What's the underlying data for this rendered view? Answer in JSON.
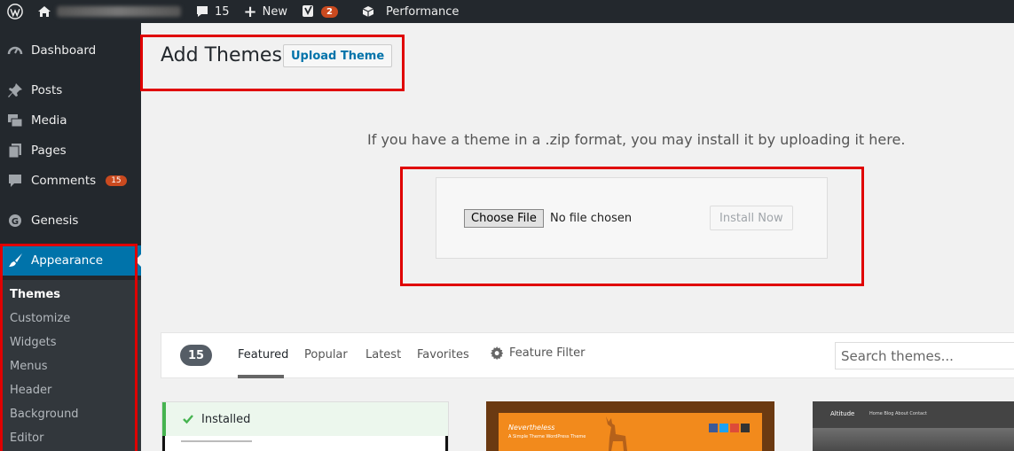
{
  "admin_bar": {
    "comments_count": "15",
    "new_label": "New",
    "seo_badge": "2",
    "performance_label": "Performance"
  },
  "sidebar": {
    "items": [
      {
        "label": "Dashboard",
        "icon": "dashboard-icon"
      },
      {
        "label": "Posts",
        "icon": "pin-icon"
      },
      {
        "label": "Media",
        "icon": "media-icon"
      },
      {
        "label": "Pages",
        "icon": "pages-icon"
      },
      {
        "label": "Comments",
        "icon": "comment-icon",
        "badge": "15"
      },
      {
        "label": "Genesis",
        "icon": "genesis-icon"
      },
      {
        "label": "Appearance",
        "icon": "paintbrush-icon",
        "active": true
      }
    ],
    "submenu": [
      "Themes",
      "Customize",
      "Widgets",
      "Menus",
      "Header",
      "Background",
      "Editor"
    ]
  },
  "main": {
    "title": "Add Themes",
    "upload_button": "Upload Theme",
    "upload_help": "If you have a theme in a .zip format, you may install it by uploading it here.",
    "choose_file": "Choose File",
    "no_file": "No file chosen",
    "install_now": "Install Now"
  },
  "filter_bar": {
    "count": "15",
    "tabs": [
      "Featured",
      "Popular",
      "Latest",
      "Favorites"
    ],
    "feature_filter": "Feature Filter",
    "search_placeholder": "Search themes..."
  },
  "themes": [
    {
      "status": "Installed"
    },
    {
      "preview_title": "Nevertheless",
      "preview_subtitle": "A Simple Theme WordPress Theme"
    },
    {
      "preview_logo": "Altitude",
      "preview_links": "Home   Blog   About   Contact"
    }
  ],
  "colors": {
    "admin_dark": "#23282d",
    "accent": "#0073aa",
    "badge": "#ca4a1f",
    "highlight": "#e00000",
    "installed_green": "#46b450"
  }
}
